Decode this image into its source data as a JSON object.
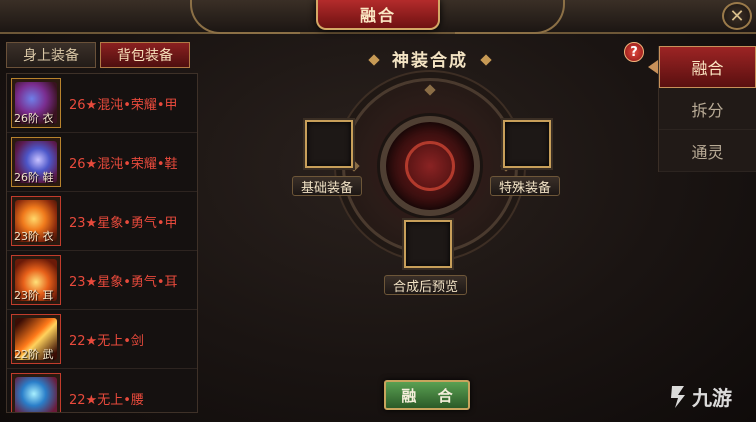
{
  "window": {
    "title": "融合"
  },
  "left_tabs": [
    {
      "label": "身上装备",
      "active": false
    },
    {
      "label": "背包装备",
      "active": true
    }
  ],
  "items": [
    {
      "grade": "26阶 衣",
      "name": "26★混沌•荣耀•甲",
      "icon": "armor-icon",
      "art": "art-blue"
    },
    {
      "grade": "26阶 鞋",
      "name": "26★混沌•荣耀•鞋",
      "icon": "boots-icon",
      "art": "art-blue2"
    },
    {
      "grade": "23阶 衣",
      "name": "23★星象•勇气•甲",
      "icon": "armor-icon",
      "art": "art-orange"
    },
    {
      "grade": "23阶 耳",
      "name": "23★星象•勇气•耳",
      "icon": "earring-icon",
      "art": "art-orange2"
    },
    {
      "grade": "22阶 武",
      "name": "22★无上•剑",
      "icon": "sword-icon",
      "art": "art-fire"
    },
    {
      "grade": "",
      "name": "22★无上•腰",
      "icon": "belt-icon",
      "art": "art-aqua"
    }
  ],
  "center": {
    "title": "神装合成",
    "help": "?",
    "slots": {
      "base": "基础装备",
      "special": "特殊装备",
      "preview": "合成后预览"
    },
    "fuse_button": "融 合"
  },
  "right_tabs": [
    {
      "label": "融合",
      "active": true
    },
    {
      "label": "拆分",
      "active": false
    },
    {
      "label": "通灵",
      "active": false
    }
  ],
  "watermark": {
    "text": "九游"
  },
  "colors": {
    "accent_red": "#9c2424",
    "gold_border": "#c89f5a",
    "item_name": "#e84a3c",
    "fuse_green": "#5aa052"
  }
}
